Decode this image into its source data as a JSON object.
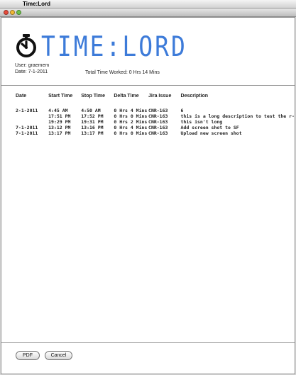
{
  "menubar": {
    "app_name": "Time:Lord"
  },
  "logo": {
    "text": "TIME:LORD"
  },
  "info": {
    "user_line": "User: graemem",
    "date_line": "Date: 7-1-2011",
    "total_line": "Total Time Worked: 0 Hrs 14 Mins"
  },
  "table": {
    "headers": [
      "Date",
      "Start Time",
      "Stop Time",
      "Delta Time",
      "Jira Issue",
      "Description"
    ],
    "rows": [
      [
        "2-1-2011",
        "4:45 AM",
        "4:50 AM",
        "0 Hrs 4 Mins",
        "CNR-163",
        "6"
      ],
      [
        "",
        "17:51 PM",
        "17:52 PM",
        "0 Hrs 0 Mins",
        "CNR-163",
        "this is a long description to test the r-"
      ],
      [
        "",
        "19:29 PM",
        "19:31 PM",
        "0 Hrs 2 Mins",
        "CNR-163",
        "this isn't long"
      ],
      [
        "7-1-2011",
        "13:12 PM",
        "13:16 PM",
        "0 Hrs 4 Mins",
        "CNR-163",
        "Add screen shot to SF"
      ],
      [
        "7-1-2011",
        "13:17 PM",
        "13:17 PM",
        "0 Hrs 0 Mins",
        "CNR-163",
        "Upload new screen shot"
      ]
    ]
  },
  "buttons": {
    "pdf": "PDF",
    "cancel": "Cancel"
  },
  "colors": {
    "logo_blue": "#3d7bd9",
    "close": "#e64b3c",
    "minimize": "#f2b935",
    "zoom": "#6ec34a"
  },
  "icons": {
    "apple": "apple-logo-icon",
    "logo": "stopwatch-icon"
  }
}
